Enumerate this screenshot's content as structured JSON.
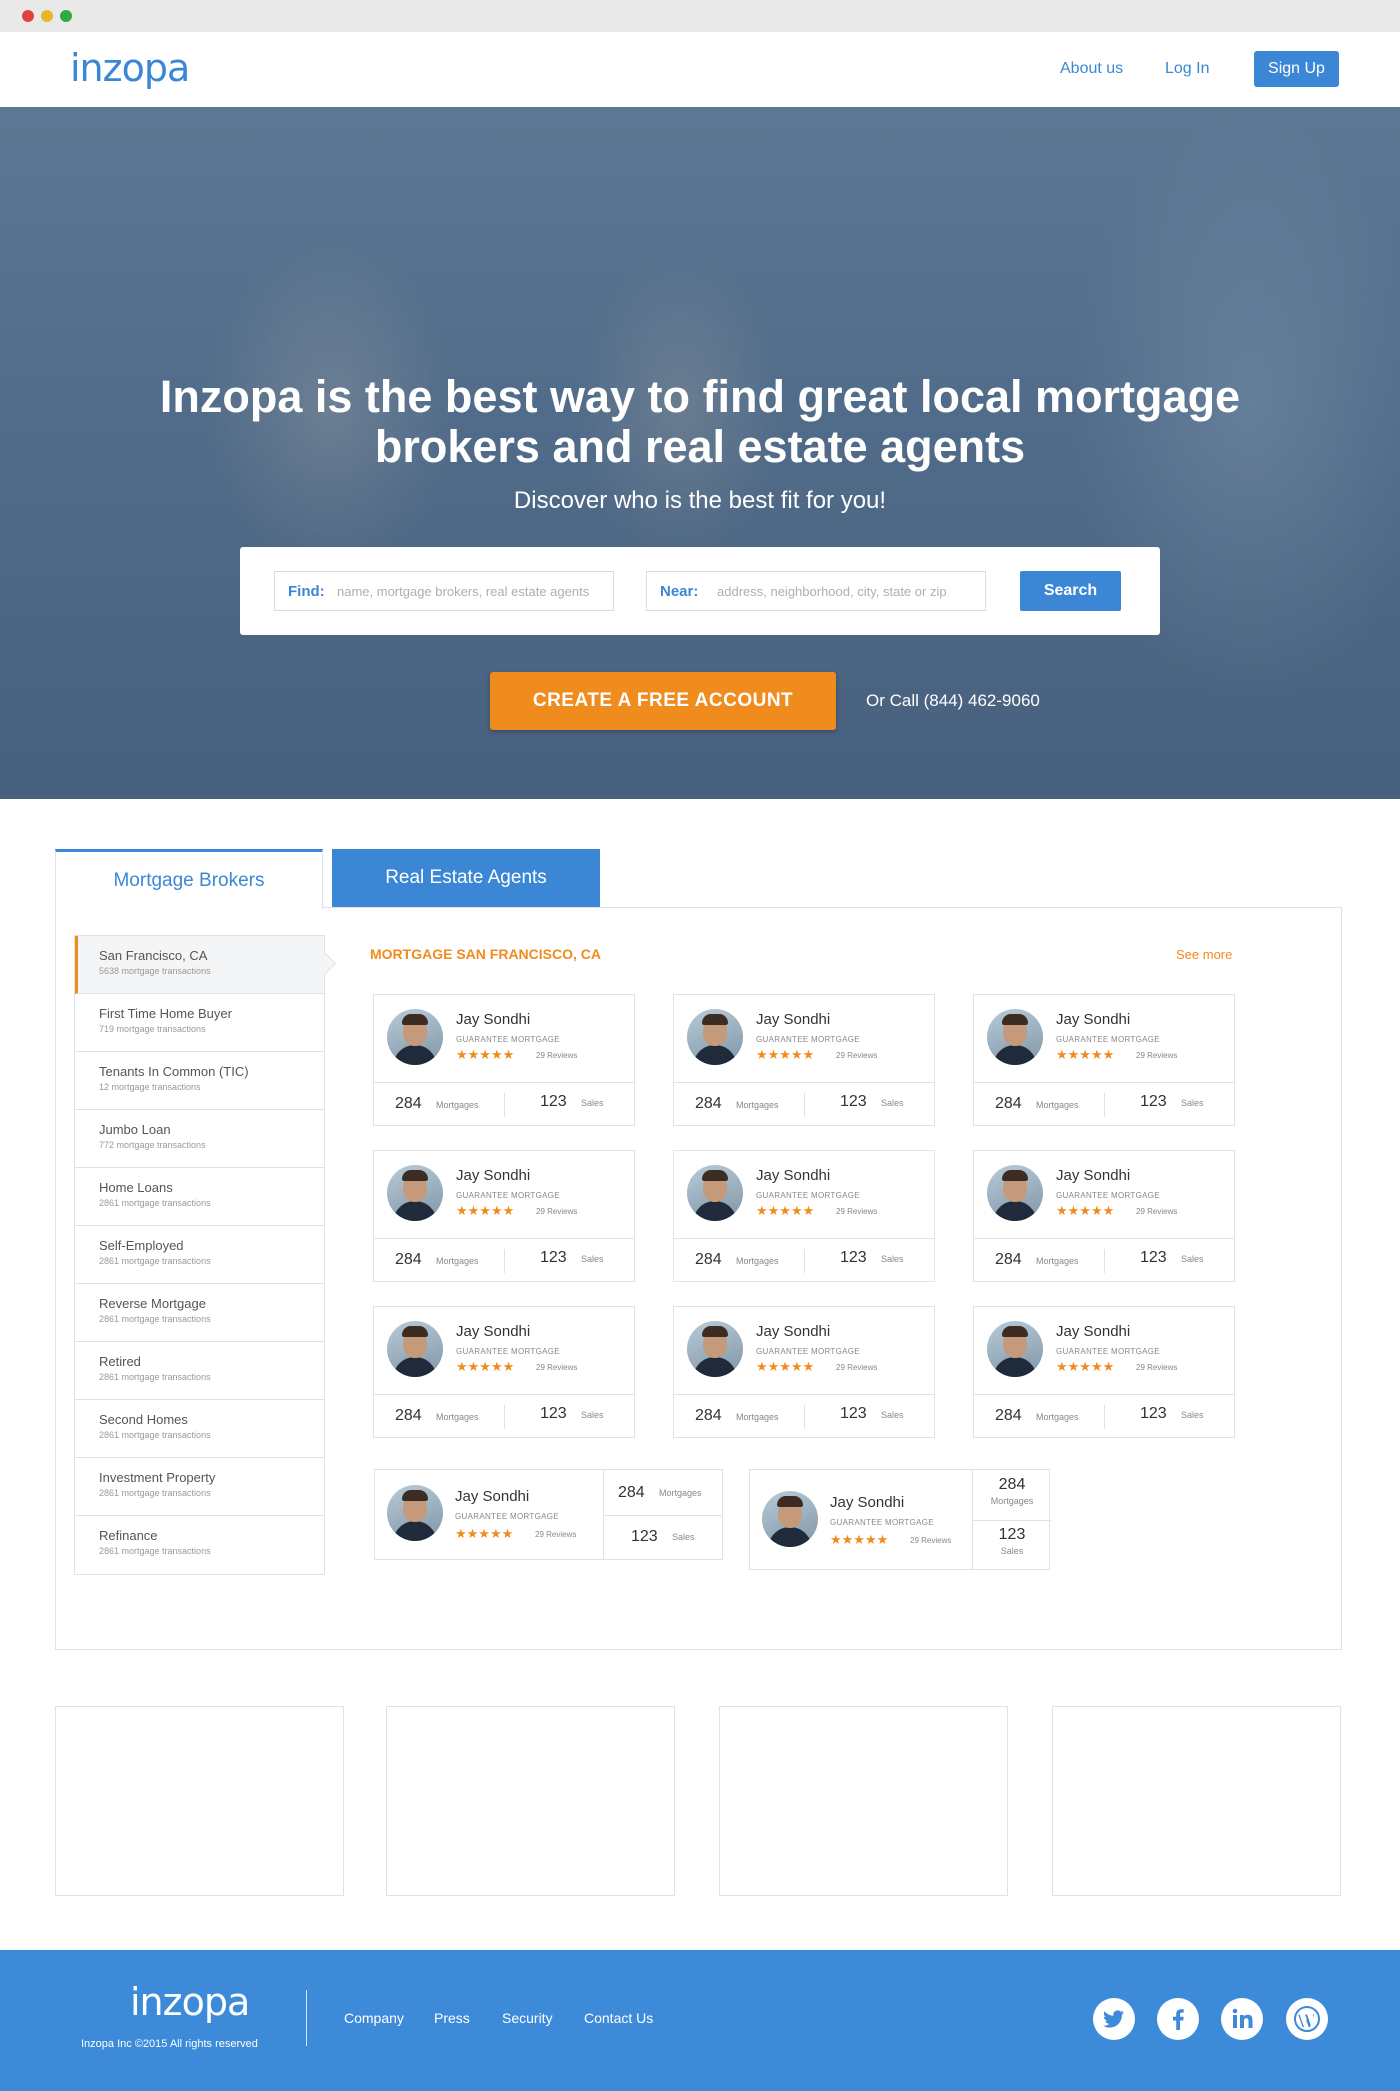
{
  "brand": {
    "logo_text": "inzopa",
    "accent": "#3b87d6",
    "orange": "#f08b1d"
  },
  "nav": {
    "about": "About us",
    "login": "Log In",
    "signup": "Sign Up"
  },
  "hero": {
    "title": "Inzopa is the best way to find great local mortgage brokers and real estate agents",
    "subtitle": "Discover who is the best fit for you!",
    "find_label": "Find:",
    "find_placeholder": "name, mortgage brokers, real estate agents",
    "near_label": "Near:",
    "near_placeholder": "address, neighborhood, city, state or zip",
    "search_button": "Search",
    "cta_button": "CREATE A FREE ACCOUNT",
    "call_text": "Or Call (844) 462-9060"
  },
  "tabs": {
    "mortgage": "Mortgage Brokers",
    "realestate": "Real Estate Agents"
  },
  "sidebar": [
    {
      "title": "San Francisco, CA",
      "sub": "5638 mortgage transactions"
    },
    {
      "title": "First Time Home Buyer",
      "sub": "719 mortgage transactions"
    },
    {
      "title": "Tenants In Common (TIC)",
      "sub": "12 mortgage transactions"
    },
    {
      "title": "Jumbo Loan",
      "sub": "772 mortgage transactions"
    },
    {
      "title": "Home Loans",
      "sub": "2861 mortgage transactions"
    },
    {
      "title": "Self-Employed",
      "sub": "2861 mortgage transactions"
    },
    {
      "title": "Reverse Mortgage",
      "sub": "2861 mortgage transactions"
    },
    {
      "title": "Retired",
      "sub": "2861 mortgage transactions"
    },
    {
      "title": "Second Homes",
      "sub": "2861 mortgage transactions"
    },
    {
      "title": "Investment Property",
      "sub": "2861 mortgage transactions"
    },
    {
      "title": "Refinance",
      "sub": "2861 mortgage transactions"
    }
  ],
  "section": {
    "title": "MORTGAGE SAN FRANCISCO, CA",
    "see_more": "See more"
  },
  "cards": [
    {
      "name": "Jay Sondhi",
      "company": "GUARANTEE MORTGAGE",
      "stars": "★★★★★",
      "reviews": "29 Reviews",
      "mortgages": "284",
      "mortgages_label": "Mortgages",
      "sales": "123",
      "sales_label": "Sales"
    },
    {
      "name": "Jay Sondhi",
      "company": "GUARANTEE MORTGAGE",
      "stars": "★★★★★",
      "reviews": "29 Reviews",
      "mortgages": "284",
      "mortgages_label": "Mortgages",
      "sales": "123",
      "sales_label": "Sales"
    },
    {
      "name": "Jay Sondhi",
      "company": "GUARANTEE MORTGAGE",
      "stars": "★★★★★",
      "reviews": "29 Reviews",
      "mortgages": "284",
      "mortgages_label": "Mortgages",
      "sales": "123",
      "sales_label": "Sales"
    },
    {
      "name": "Jay Sondhi",
      "company": "GUARANTEE MORTGAGE",
      "stars": "★★★★★",
      "reviews": "29 Reviews",
      "mortgages": "284",
      "mortgages_label": "Mortgages",
      "sales": "123",
      "sales_label": "Sales"
    },
    {
      "name": "Jay Sondhi",
      "company": "GUARANTEE MORTGAGE",
      "stars": "★★★★★",
      "reviews": "29 Reviews",
      "mortgages": "284",
      "mortgages_label": "Mortgages",
      "sales": "123",
      "sales_label": "Sales"
    },
    {
      "name": "Jay Sondhi",
      "company": "GUARANTEE MORTGAGE",
      "stars": "★★★★★",
      "reviews": "29 Reviews",
      "mortgages": "284",
      "mortgages_label": "Mortgages",
      "sales": "123",
      "sales_label": "Sales"
    },
    {
      "name": "Jay Sondhi",
      "company": "GUARANTEE MORTGAGE",
      "stars": "★★★★★",
      "reviews": "29 Reviews",
      "mortgages": "284",
      "mortgages_label": "Mortgages",
      "sales": "123",
      "sales_label": "Sales"
    },
    {
      "name": "Jay Sondhi",
      "company": "GUARANTEE MORTGAGE",
      "stars": "★★★★★",
      "reviews": "29 Reviews",
      "mortgages": "284",
      "mortgages_label": "Mortgages",
      "sales": "123",
      "sales_label": "Sales"
    },
    {
      "name": "Jay Sondhi",
      "company": "GUARANTEE MORTGAGE",
      "stars": "★★★★★",
      "reviews": "29 Reviews",
      "mortgages": "284",
      "mortgages_label": "Mortgages",
      "sales": "123",
      "sales_label": "Sales"
    },
    {
      "name": "Jay Sondhi",
      "company": "GUARANTEE MORTGAGE",
      "stars": "★★★★★",
      "reviews": "29 Reviews",
      "mortgages": "284",
      "mortgages_label": "Mortgages",
      "sales": "123",
      "sales_label": "Sales"
    },
    {
      "name": "Jay Sondhi",
      "company": "GUARANTEE MORTGAGE",
      "stars": "★★★★★",
      "reviews": "29 Reviews",
      "mortgages": "284",
      "mortgages_label": "Mortgages",
      "sales": "123",
      "sales_label": "Sales"
    }
  ],
  "footer": {
    "logo_text": "inzopa",
    "copyright": "Inzopa Inc ©2015 All rights reserved",
    "company": "Company",
    "press": "Press",
    "security": "Security",
    "contact": "Contact Us",
    "social_twitter": "twitter-icon",
    "social_facebook": "facebook-icon",
    "social_linkedin": "linkedin-icon",
    "social_wordpress": "wordpress-icon"
  }
}
